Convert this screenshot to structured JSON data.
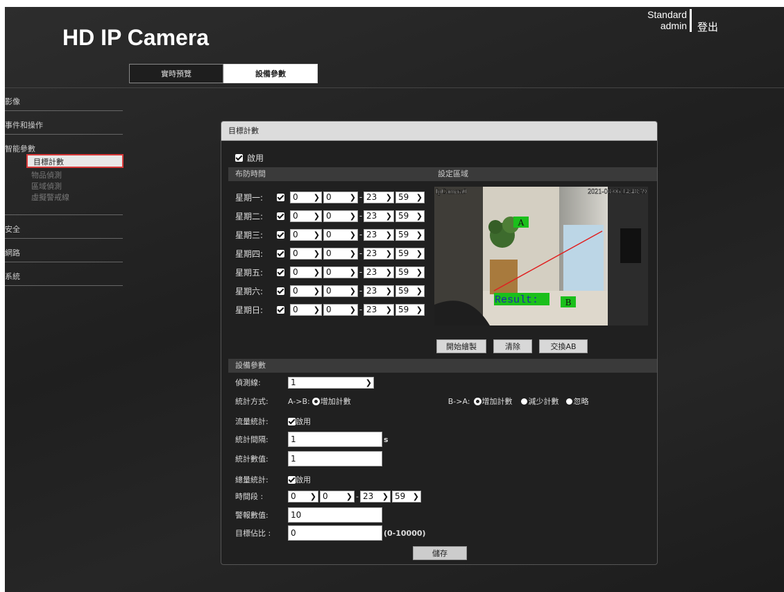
{
  "header": {
    "logo": "HD IP Camera",
    "user_mode": "Standard",
    "username": "admin",
    "logout": "登出"
  },
  "tabs": [
    {
      "label": "實時預覽",
      "active": false
    },
    {
      "label": "設備參數",
      "active": true
    }
  ],
  "sidebar": {
    "sections": [
      {
        "label": "影像"
      },
      {
        "label": "事件和操作"
      },
      {
        "label": "智能參數",
        "items": [
          "目標計數",
          "物品偵測",
          "區域偵測",
          "虛擬警戒線"
        ],
        "selected": "目標計數"
      },
      {
        "label": "安全"
      },
      {
        "label": "網路"
      },
      {
        "label": "系統"
      }
    ]
  },
  "panel": {
    "title": "目標計數",
    "enable_label": "啟用",
    "schedule": {
      "header": "布防時間",
      "days": [
        {
          "day": "星期一:",
          "start_h": "0",
          "start_m": "0",
          "end_h": "23",
          "end_m": "59"
        },
        {
          "day": "星期二:",
          "start_h": "0",
          "start_m": "0",
          "end_h": "23",
          "end_m": "59"
        },
        {
          "day": "星期三:",
          "start_h": "0",
          "start_m": "0",
          "end_h": "23",
          "end_m": "59"
        },
        {
          "day": "星期四:",
          "start_h": "0",
          "start_m": "0",
          "end_h": "23",
          "end_m": "59"
        },
        {
          "day": "星期五:",
          "start_h": "0",
          "start_m": "0",
          "end_h": "23",
          "end_m": "59"
        },
        {
          "day": "星期六:",
          "start_h": "0",
          "start_m": "0",
          "end_h": "23",
          "end_m": "59"
        },
        {
          "day": "星期日:",
          "start_h": "0",
          "start_m": "0",
          "end_h": "23",
          "end_m": "59"
        }
      ]
    },
    "region": {
      "header": "設定區域",
      "overlay_camera": "IpCamera0",
      "overlay_time": "2021-08-06 14:48:59",
      "label_a": "A",
      "label_b": "B",
      "result_label": "Result:",
      "buttons": [
        "開始繪製",
        "清除",
        "交換AB"
      ]
    },
    "params": {
      "header": "設備參數",
      "detect_line_label": "偵測線:",
      "detect_line_value": "1",
      "count_mode_label": "統計方式:",
      "ab_label": "A->B:",
      "ab_option": "增加計數",
      "ba_label": "B->A:",
      "ba_options": [
        "增加計數",
        "減少計數",
        "忽略"
      ],
      "flow_label": "流量統計:",
      "flow_enable": "啟用",
      "interval_label": "統計間隔:",
      "interval_value": "1",
      "interval_unit": "s",
      "count_value_label": "統計數值:",
      "count_value": "1",
      "total_label": "總量統計:",
      "total_enable": "啟用",
      "period_label": "時間段 :",
      "period": {
        "start_h": "0",
        "start_m": "0",
        "end_h": "23",
        "end_m": "59"
      },
      "alarm_label": "警報數值:",
      "alarm_value": "10",
      "ratio_label": "目標佔比 :",
      "ratio_value": "0",
      "ratio_range": "(0-10000)",
      "save": "儲存"
    }
  }
}
